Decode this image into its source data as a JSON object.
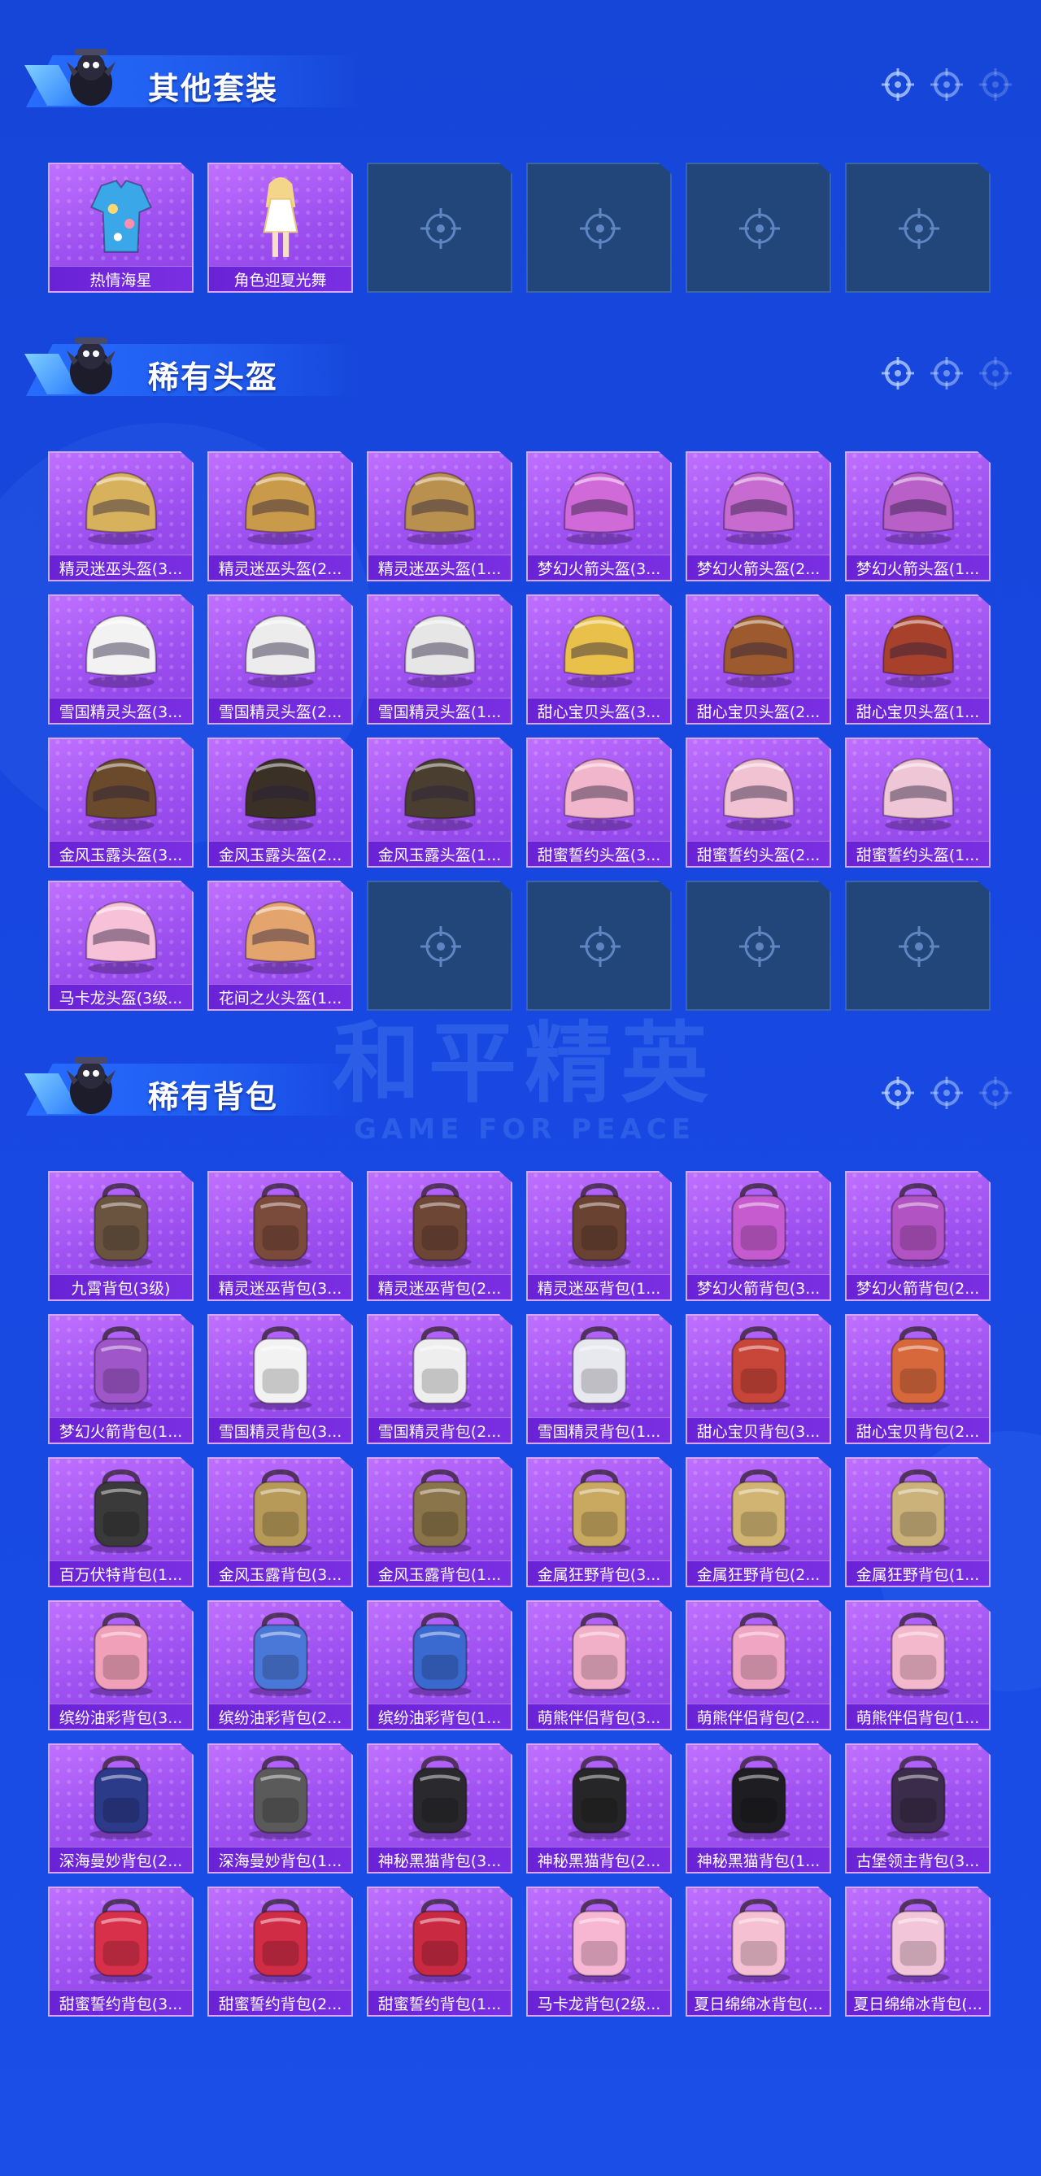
{
  "background_watermark": {
    "title": "和平精英",
    "subtitle": "GAME FOR PEACE"
  },
  "sections": [
    {
      "title": "其他套装",
      "items": [
        {
          "label": "热情海星",
          "icon": "outfit-icon",
          "color": "#3aa7e8"
        },
        {
          "label": "角色迎夏光舞",
          "icon": "character-icon",
          "color": "#f3d68a"
        },
        {
          "label": "",
          "icon": "empty-slot",
          "color": ""
        },
        {
          "label": "",
          "icon": "empty-slot",
          "color": ""
        },
        {
          "label": "",
          "icon": "empty-slot",
          "color": ""
        },
        {
          "label": "",
          "icon": "empty-slot",
          "color": ""
        }
      ]
    },
    {
      "title": "稀有头盔",
      "items": [
        {
          "label": "精灵迷巫头盔(3...",
          "icon": "helmet-icon",
          "color": "#d8b15c"
        },
        {
          "label": "精灵迷巫头盔(2...",
          "icon": "helmet-icon",
          "color": "#c99a4a"
        },
        {
          "label": "精灵迷巫头盔(1...",
          "icon": "helmet-icon",
          "color": "#b9904e"
        },
        {
          "label": "梦幻火箭头盔(3...",
          "icon": "helmet-icon",
          "color": "#d06ad8"
        },
        {
          "label": "梦幻火箭头盔(2...",
          "icon": "helmet-icon",
          "color": "#c76bd0"
        },
        {
          "label": "梦幻火箭头盔(1...",
          "icon": "helmet-icon",
          "color": "#b95fc8"
        },
        {
          "label": "雪国精灵头盔(3...",
          "icon": "helmet-icon",
          "color": "#f2f2f2"
        },
        {
          "label": "雪国精灵头盔(2...",
          "icon": "helmet-icon",
          "color": "#ececec"
        },
        {
          "label": "雪国精灵头盔(1...",
          "icon": "helmet-icon",
          "color": "#e6e6e6"
        },
        {
          "label": "甜心宝贝头盔(3...",
          "icon": "helmet-icon",
          "color": "#e8c04a"
        },
        {
          "label": "甜心宝贝头盔(2...",
          "icon": "helmet-icon",
          "color": "#9c5a2e"
        },
        {
          "label": "甜心宝贝头盔(1...",
          "icon": "helmet-icon",
          "color": "#a8412c"
        },
        {
          "label": "金风玉露头盔(3...",
          "icon": "helmet-icon",
          "color": "#6a4a2a"
        },
        {
          "label": "金风玉露头盔(2...",
          "icon": "helmet-icon",
          "color": "#3a3026"
        },
        {
          "label": "金风玉露头盔(1...",
          "icon": "helmet-icon",
          "color": "#4a3e30"
        },
        {
          "label": "甜蜜誓约头盔(3...",
          "icon": "helmet-icon",
          "color": "#f2b6cc"
        },
        {
          "label": "甜蜜誓约头盔(2...",
          "icon": "helmet-icon",
          "color": "#f0c2d2"
        },
        {
          "label": "甜蜜誓约头盔(1...",
          "icon": "helmet-icon",
          "color": "#eec6d6"
        },
        {
          "label": "马卡龙头盔(3级...",
          "icon": "helmet-icon",
          "color": "#f7c2d8"
        },
        {
          "label": "花间之火头盔(1...",
          "icon": "helmet-icon",
          "color": "#e3a46e"
        },
        {
          "label": "",
          "icon": "empty-slot",
          "color": ""
        },
        {
          "label": "",
          "icon": "empty-slot",
          "color": ""
        },
        {
          "label": "",
          "icon": "empty-slot",
          "color": ""
        },
        {
          "label": "",
          "icon": "empty-slot",
          "color": ""
        }
      ]
    },
    {
      "title": "稀有背包",
      "items": [
        {
          "label": "九霄背包(3级)",
          "icon": "backpack-icon",
          "color": "#6a5440"
        },
        {
          "label": "精灵迷巫背包(3...",
          "icon": "backpack-icon",
          "color": "#7a4a3a"
        },
        {
          "label": "精灵迷巫背包(2...",
          "icon": "backpack-icon",
          "color": "#6e4636"
        },
        {
          "label": "精灵迷巫背包(1...",
          "icon": "backpack-icon",
          "color": "#6a4232"
        },
        {
          "label": "梦幻火箭背包(3...",
          "icon": "backpack-icon",
          "color": "#c65bd0"
        },
        {
          "label": "梦幻火箭背包(2...",
          "icon": "backpack-icon",
          "color": "#b253c4"
        },
        {
          "label": "梦幻火箭背包(1...",
          "icon": "backpack-icon",
          "color": "#9f56c8"
        },
        {
          "label": "雪国精灵背包(3...",
          "icon": "backpack-icon",
          "color": "#f2f2f2"
        },
        {
          "label": "雪国精灵背包(2...",
          "icon": "backpack-icon",
          "color": "#eeeeee"
        },
        {
          "label": "雪国精灵背包(1...",
          "icon": "backpack-icon",
          "color": "#e8e8ef"
        },
        {
          "label": "甜心宝贝背包(3...",
          "icon": "backpack-icon",
          "color": "#c8453a"
        },
        {
          "label": "甜心宝贝背包(2...",
          "icon": "backpack-icon",
          "color": "#d7683c"
        },
        {
          "label": "百万伏特背包(1...",
          "icon": "backpack-icon",
          "color": "#3a3a3a"
        },
        {
          "label": "金风玉露背包(3...",
          "icon": "backpack-icon",
          "color": "#b79a58"
        },
        {
          "label": "金风玉露背包(1...",
          "icon": "backpack-icon",
          "color": "#8a744a"
        },
        {
          "label": "金属狂野背包(3...",
          "icon": "backpack-icon",
          "color": "#c9a860"
        },
        {
          "label": "金属狂野背包(2...",
          "icon": "backpack-icon",
          "color": "#d1b472"
        },
        {
          "label": "金属狂野背包(1...",
          "icon": "backpack-icon",
          "color": "#cbb27a"
        },
        {
          "label": "缤纷油彩背包(3...",
          "icon": "backpack-icon",
          "color": "#f0a0b8"
        },
        {
          "label": "缤纷油彩背包(2...",
          "icon": "backpack-icon",
          "color": "#4a78d8"
        },
        {
          "label": "缤纷油彩背包(1...",
          "icon": "backpack-icon",
          "color": "#3a6ad0"
        },
        {
          "label": "萌熊伴侣背包(3...",
          "icon": "backpack-icon",
          "color": "#f2b0c8"
        },
        {
          "label": "萌熊伴侣背包(2...",
          "icon": "backpack-icon",
          "color": "#f0a6c2"
        },
        {
          "label": "萌熊伴侣背包(1...",
          "icon": "backpack-icon",
          "color": "#f4b8cc"
        },
        {
          "label": "深海曼妙背包(2...",
          "icon": "backpack-icon",
          "color": "#2c3a8a"
        },
        {
          "label": "深海曼妙背包(1...",
          "icon": "backpack-icon",
          "color": "#5a5a5a"
        },
        {
          "label": "神秘黑猫背包(3...",
          "icon": "backpack-icon",
          "color": "#2a2a2e"
        },
        {
          "label": "神秘黑猫背包(2...",
          "icon": "backpack-icon",
          "color": "#262628"
        },
        {
          "label": "神秘黑猫背包(1...",
          "icon": "backpack-icon",
          "color": "#1e1e22"
        },
        {
          "label": "古堡领主背包(3...",
          "icon": "backpack-icon",
          "color": "#3a2c4a"
        },
        {
          "label": "甜蜜誓约背包(3...",
          "icon": "backpack-icon",
          "color": "#d8304a"
        },
        {
          "label": "甜蜜誓约背包(2...",
          "icon": "backpack-icon",
          "color": "#d02c46"
        },
        {
          "label": "甜蜜誓约背包(1...",
          "icon": "backpack-icon",
          "color": "#c92a42"
        },
        {
          "label": "马卡龙背包(2级...",
          "icon": "backpack-icon",
          "color": "#f7b6d2"
        },
        {
          "label": "夏日绵绵冰背包(...",
          "icon": "backpack-icon",
          "color": "#f4c0d2"
        },
        {
          "label": "夏日绵绵冰背包(...",
          "icon": "backpack-icon",
          "color": "#f2c6d8"
        }
      ]
    }
  ]
}
